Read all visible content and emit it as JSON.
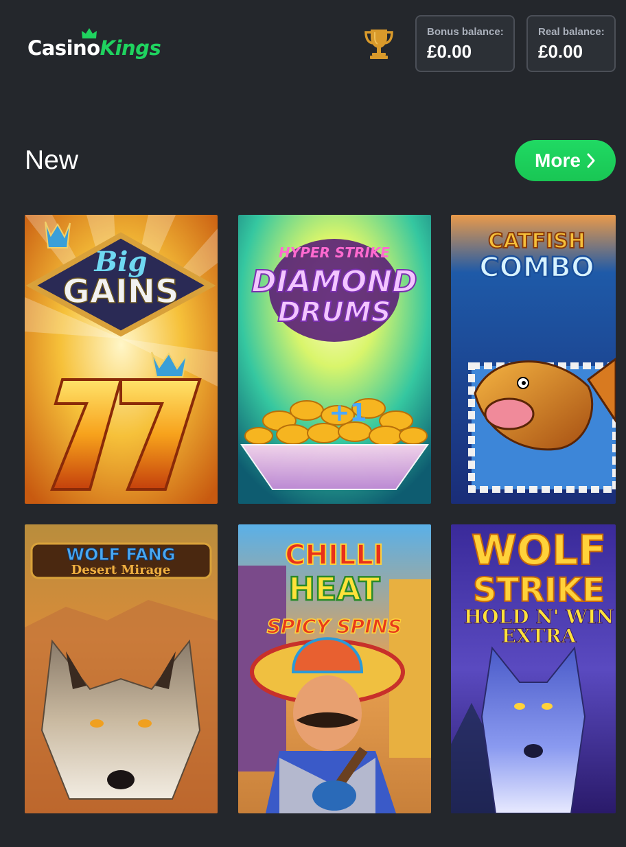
{
  "brand": {
    "casino": "Casino",
    "kings": "Kings",
    "accent_color": "#1fd35f"
  },
  "header": {
    "trophy_icon": "trophy-icon",
    "bonus_balance": {
      "label": "Bonus balance:",
      "value": "£0.00"
    },
    "real_balance": {
      "label": "Real balance:",
      "value": "£0.00"
    }
  },
  "section": {
    "title": "New",
    "more_label": "More",
    "more_icon": "chevron-right-icon",
    "more_color": "#1ed760"
  },
  "games": [
    {
      "line1": "Big",
      "line2": "GAINS"
    },
    {
      "line1": "HYPER STRIKE",
      "line2": "DIAMOND",
      "line3": "DRUMS"
    },
    {
      "line1": "CATFISH",
      "line2": "COMBO"
    },
    {
      "line1": "WOLF FANG",
      "line2": "Desert Mirage"
    },
    {
      "line1": "CHILLI",
      "line2": "HEAT",
      "line3": "SPICY SPINS"
    },
    {
      "line1": "WOLF",
      "line2": "STRIKE",
      "line3": "HOLD N' WIN",
      "line4": "EXTRA"
    }
  ]
}
